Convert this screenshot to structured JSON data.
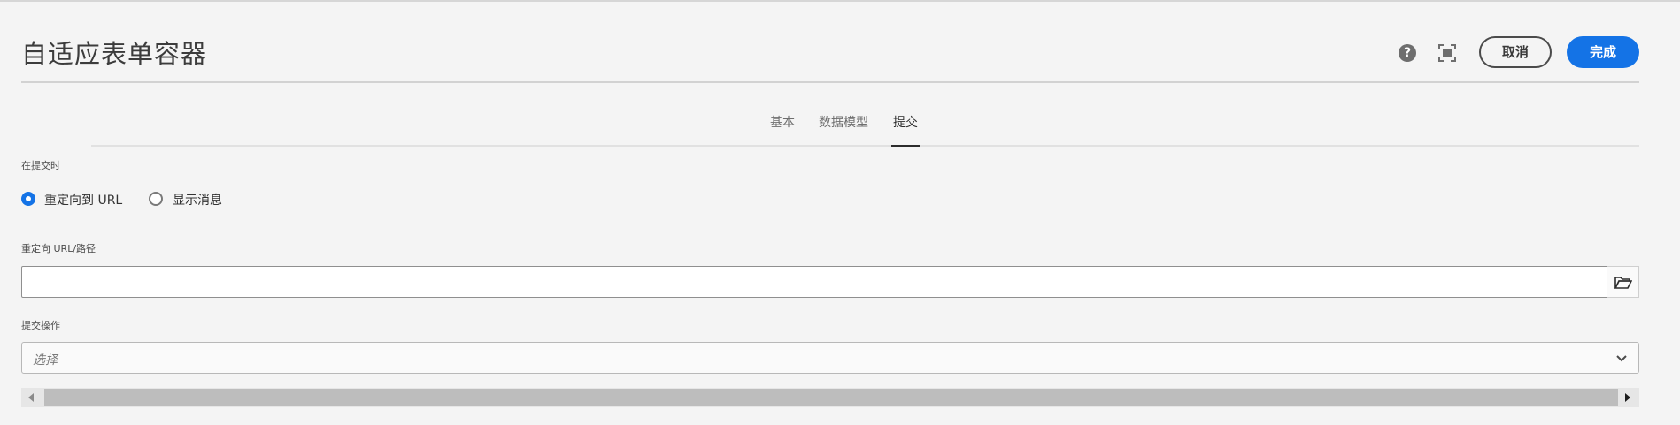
{
  "header": {
    "title": "自适应表单容器",
    "help_icon": "?",
    "cancel_label": "取消",
    "done_label": "完成"
  },
  "tabs": [
    {
      "label": "基本",
      "active": false
    },
    {
      "label": "数据模型",
      "active": false
    },
    {
      "label": "提交",
      "active": true
    }
  ],
  "on_submit": {
    "label": "在提交时",
    "options": [
      {
        "label": "重定向到 URL",
        "checked": true
      },
      {
        "label": "显示消息",
        "checked": false
      }
    ]
  },
  "redirect": {
    "label": "重定向 URL/路径",
    "value": ""
  },
  "submit_action": {
    "label": "提交操作",
    "placeholder": "选择"
  },
  "colors": {
    "accent": "#1473e6",
    "background": "#f4f4f4"
  }
}
